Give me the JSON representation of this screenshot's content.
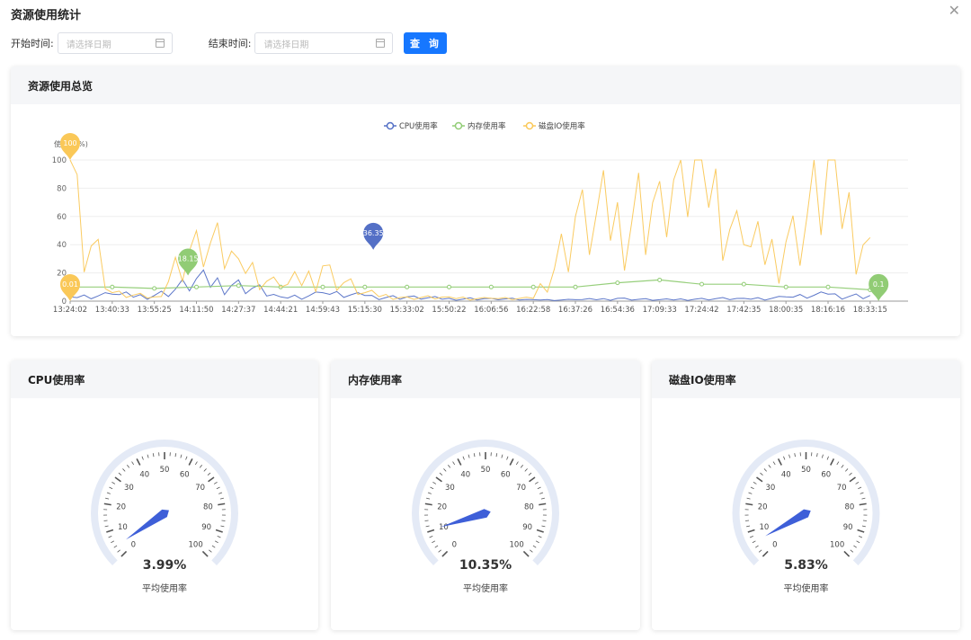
{
  "window": {
    "title": "资源使用统计",
    "close_icon": "close-icon"
  },
  "filters": {
    "start_label": "开始时间:",
    "start_placeholder": "请选择日期",
    "end_label": "结束时间:",
    "end_placeholder": "请选择日期",
    "query_label": "查 询"
  },
  "overview": {
    "title": "资源使用总览",
    "legend": [
      "CPU使用率",
      "内存使用率",
      "磁盘IO使用率"
    ],
    "ylabel": "使用率(%)",
    "pins": [
      {
        "label": "100",
        "series": "disk",
        "x_index": 0,
        "y": 100
      },
      {
        "label": "0.01",
        "series": "disk",
        "x_index": 0,
        "y": 0.01
      },
      {
        "label": "18.15",
        "series": "memory",
        "x_index": 2.8,
        "y": 18.15
      },
      {
        "label": "36.35",
        "series": "cpu",
        "x_index": 7.2,
        "y": 36.35
      },
      {
        "label": "0.1",
        "series": "memory",
        "x_index": 19.2,
        "y": 0.1
      }
    ]
  },
  "chart_data": {
    "type": "line",
    "title": "",
    "xlabel": "",
    "ylabel": "使用率(%)",
    "ylim": [
      0,
      100
    ],
    "yticks": [
      0,
      20,
      40,
      60,
      80,
      100
    ],
    "categories": [
      "13:24:02",
      "13:40:33",
      "13:55:25",
      "14:11:50",
      "14:27:37",
      "14:44:21",
      "14:59:43",
      "15:15:30",
      "15:33:02",
      "15:50:22",
      "16:06:56",
      "16:22:58",
      "16:37:26",
      "16:54:36",
      "17:09:33",
      "17:24:42",
      "17:42:35",
      "18:00:35",
      "18:16:16",
      "18:33:15"
    ],
    "grid": true,
    "legend_position": "top-center",
    "series": [
      {
        "name": "CPU使用率",
        "color": "#5470c6",
        "values": [
          3,
          5,
          4,
          16,
          15,
          3,
          6,
          4,
          3,
          2,
          2,
          1,
          1,
          2,
          1,
          2,
          2,
          3,
          5,
          4
        ]
      },
      {
        "name": "内存使用率",
        "color": "#91cc75",
        "values": [
          10,
          10,
          9,
          10,
          11,
          10,
          10,
          10,
          10,
          10,
          10,
          10,
          10,
          13,
          15,
          12,
          12,
          10,
          10,
          8
        ]
      },
      {
        "name": "磁盘IO使用率",
        "color": "#fac858",
        "values": [
          100,
          6,
          3,
          50,
          30,
          10,
          25,
          6,
          3,
          3,
          2,
          2,
          60,
          70,
          85,
          100,
          40,
          42,
          100,
          45
        ]
      }
    ]
  },
  "gauges": [
    {
      "title": "CPU使用率",
      "value": 3.99,
      "display": "3.99%",
      "subtitle": "平均使用率"
    },
    {
      "title": "内存使用率",
      "value": 10.35,
      "display": "10.35%",
      "subtitle": "平均使用率"
    },
    {
      "title": "磁盘IO使用率",
      "value": 5.83,
      "display": "5.83%",
      "subtitle": "平均使用率"
    }
  ],
  "gauge_scale": {
    "min": 0,
    "max": 100,
    "labels": [
      0,
      10,
      20,
      30,
      40,
      50,
      60,
      70,
      80,
      90,
      100
    ]
  },
  "colors": {
    "primary": "#1677ff",
    "gauge_track": "#e4eaf6",
    "gauge_pointer": "#3e5fd8"
  }
}
